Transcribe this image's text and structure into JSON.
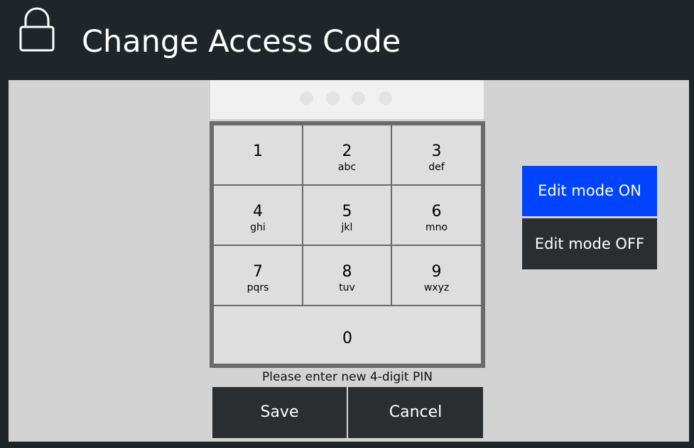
{
  "header": {
    "title": "Change Access Code",
    "icon": "lock-icon"
  },
  "pin": {
    "length": 4,
    "entered_digits": 0
  },
  "keypad": {
    "keys": [
      {
        "digit": "1",
        "letters": ""
      },
      {
        "digit": "2",
        "letters": "abc"
      },
      {
        "digit": "3",
        "letters": "def"
      },
      {
        "digit": "4",
        "letters": "ghi"
      },
      {
        "digit": "5",
        "letters": "jkl"
      },
      {
        "digit": "6",
        "letters": "mno"
      },
      {
        "digit": "7",
        "letters": "pqrs"
      },
      {
        "digit": "8",
        "letters": "tuv"
      },
      {
        "digit": "9",
        "letters": "wxyz"
      },
      {
        "digit": "0",
        "letters": ""
      }
    ]
  },
  "prompt": "Please enter new 4-digit PIN",
  "actions": {
    "save_label": "Save",
    "cancel_label": "Cancel"
  },
  "edit_mode": {
    "on_label": "Edit mode ON",
    "off_label": "Edit mode OFF",
    "active": "on"
  },
  "colors": {
    "background": "#1f2528",
    "panel": "#d3d3d3",
    "key": "#dedede",
    "keypad_frame": "#6a6a6a",
    "active_blue": "#0044ff",
    "dark_button": "#2b2e30"
  }
}
